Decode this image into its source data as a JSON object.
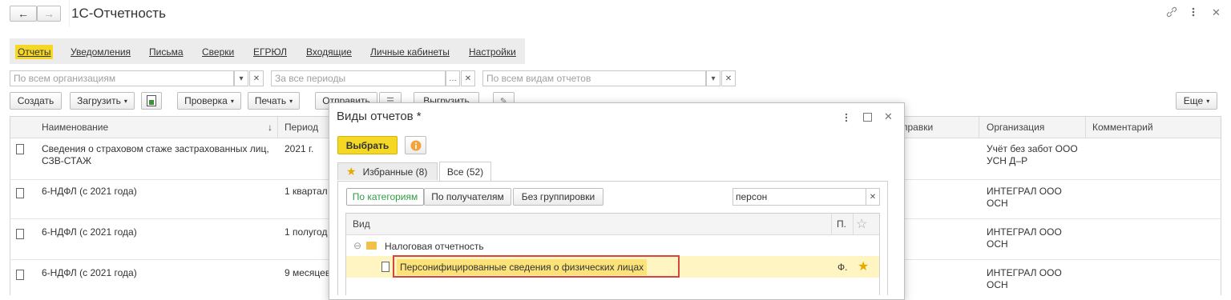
{
  "window": {
    "title": "1С-Отчетность",
    "back_icon": "←",
    "forward_icon": "→"
  },
  "nav": {
    "items": [
      "Отчеты",
      "Уведомления",
      "Письма",
      "Сверки",
      "ЕГРЮЛ",
      "Входящие",
      "Личные кабинеты",
      "Настройки"
    ]
  },
  "filters": {
    "org_placeholder": "По всем организациям",
    "period_placeholder": "За все периоды",
    "type_placeholder": "По всем видам отчетов"
  },
  "toolbar": {
    "create": "Создать",
    "load": "Загрузить",
    "check": "Проверка",
    "print": "Печать",
    "send": "Отправить",
    "export": "Выгрузить",
    "more": "Еще"
  },
  "table": {
    "columns": {
      "name": "Наименование",
      "period": "Период",
      "send": "правки",
      "org": "Организация",
      "comment": "Комментарий"
    },
    "rows": [
      {
        "name1": "Сведения о страховом стаже застрахованных лиц,",
        "name2": "СЗВ-СТАЖ",
        "period": "2021 г.",
        "org1": "Учёт без забот ООО",
        "org2": "УСН Д–Р"
      },
      {
        "name1": "6-НДФЛ (с 2021 года)",
        "period": "1 квартал",
        "org1": "ИНТЕГРАЛ ООО",
        "org2": "ОСН"
      },
      {
        "name1": "6-НДФЛ (с 2021 года)",
        "period": "1 полугод",
        "org1": "ИНТЕГРАЛ ООО",
        "org2": "ОСН"
      },
      {
        "name1": "6-НДФЛ (с 2021 года)",
        "period": "9 месяцев",
        "org1": "ИНТЕГРАЛ ООО",
        "org2": "ОСН"
      }
    ]
  },
  "dialog": {
    "title": "Виды отчетов *",
    "select_button": "Выбрать",
    "tabs": {
      "favorites": "Избранные (8)",
      "all": "Все (52)"
    },
    "group_buttons": [
      "По категориям",
      "По получателям",
      "Без группировки"
    ],
    "search_value": "персон",
    "grid_columns": {
      "type": "Вид",
      "p": "П."
    },
    "category": "Налоговая отчетность",
    "item": {
      "name": "Персонифицированные сведения о физических лицах",
      "p": "Ф."
    }
  },
  "colors": {
    "accent": "#f5d726",
    "highlight_row": "#fff5c2",
    "red_frame": "#d9453c"
  }
}
